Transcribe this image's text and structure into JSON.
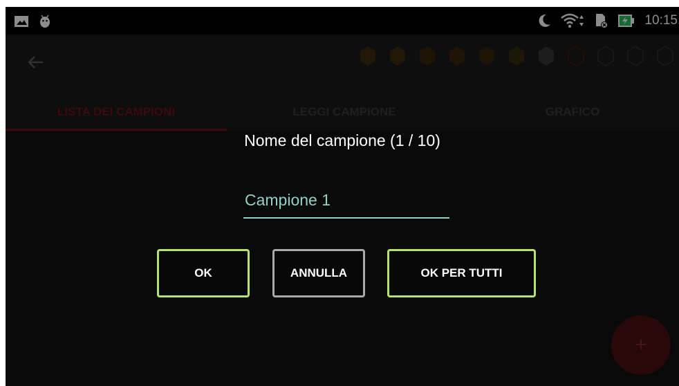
{
  "status_bar": {
    "time": "10:15"
  },
  "app_bar": {
    "progress_icons": [
      "hex-filled",
      "hex-filled",
      "hex-filled",
      "hex-filled",
      "hex-filled",
      "hex-filled",
      "hex-filled",
      "hex-outline",
      "hex-outline",
      "hex-outline",
      "hex-outline"
    ]
  },
  "tabs": [
    {
      "label": "LISTA DEI CAMPIONI"
    },
    {
      "label": "LEGGI CAMPIONE"
    },
    {
      "label": "GRAFICO"
    }
  ],
  "dialog": {
    "title": "Nome del campione (1 / 10)",
    "input_value": "Campione 1",
    "ok_label": "OK",
    "cancel_label": "ANNULLA",
    "ok_all_label": "OK PER TUTTI"
  },
  "fab": {
    "label": "+"
  },
  "colors": {
    "accent_border": "#b5e36b",
    "input_text": "#8fd3c8",
    "tab_active": "#6d1414"
  }
}
